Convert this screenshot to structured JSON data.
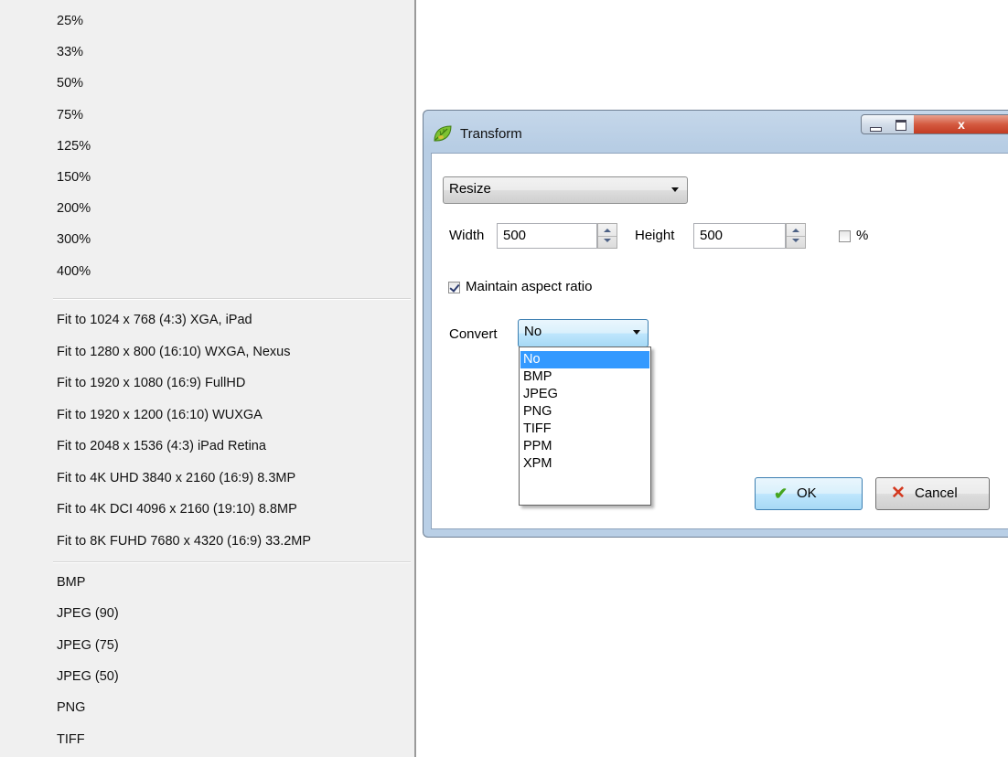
{
  "menu": {
    "zoom_items": [
      "25%",
      "33%",
      "50%",
      "75%",
      "125%",
      "150%",
      "200%",
      "300%",
      "400%"
    ],
    "fit_items": [
      "Fit to 1024 x 768 (4:3) XGA, iPad",
      "Fit to 1280 x 800 (16:10) WXGA, Nexus",
      "Fit to 1920 x 1080 (16:9) FullHD",
      "Fit to 1920 x 1200 (16:10) WUXGA",
      "Fit to 2048 x 1536 (4:3) iPad Retina",
      "Fit to 4K UHD 3840 x 2160 (16:9) 8.3MP",
      "Fit to 4K DCI 4096 x 2160 (19:10) 8.8MP",
      "Fit to 8K FUHD 7680 x 4320 (16:9) 33.2MP"
    ],
    "format_items": [
      "BMP",
      "JPEG (90)",
      "JPEG (75)",
      "JPEG (50)",
      "PNG",
      "TIFF"
    ]
  },
  "dialog": {
    "title": "Transform",
    "app_icon": "leaf-icon",
    "close_glyph": "x",
    "mode": "Resize",
    "width_label": "Width",
    "width_value": "500",
    "height_label": "Height",
    "height_value": "500",
    "percent_label": "%",
    "percent_checked": false,
    "maintain_label": "Maintain aspect ratio",
    "maintain_checked": true,
    "convert_label": "Convert",
    "convert_value": "No",
    "convert_options": [
      "No",
      "BMP",
      "JPEG",
      "PNG",
      "TIFF",
      "PPM",
      "XPM"
    ],
    "convert_selected": "No",
    "ok_label": "OK",
    "cancel_label": "Cancel",
    "ok_icon": "checkmark-icon",
    "cancel_icon": "x-icon",
    "colors": {
      "selection": "#3399ff",
      "titlebar": "#b9cfe6",
      "close_button": "#c23b22",
      "ok_check": "#46a51f",
      "cancel_x": "#d4391f"
    }
  }
}
